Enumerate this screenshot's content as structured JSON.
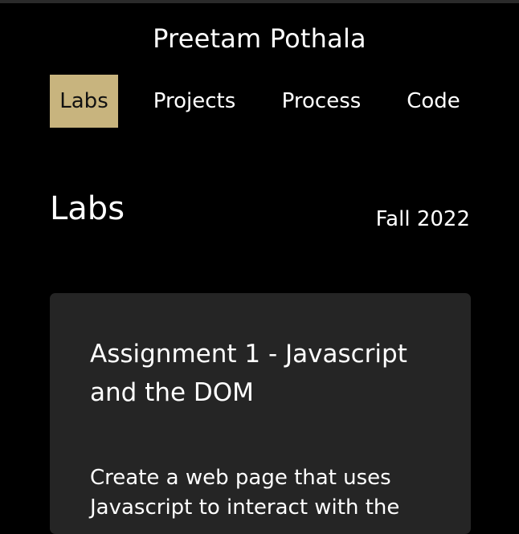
{
  "site": {
    "title": "Preetam Pothala"
  },
  "nav": {
    "items": [
      {
        "label": "Labs",
        "active": true
      },
      {
        "label": "Projects",
        "active": false
      },
      {
        "label": "Process",
        "active": false
      },
      {
        "label": "Code",
        "active": false
      }
    ]
  },
  "main": {
    "heading": "Labs",
    "term": "Fall 2022",
    "cards": [
      {
        "title": "Assignment 1 - Javascript and the DOM",
        "description": "Create a web page that uses Javascript to interact with the"
      }
    ]
  },
  "colors": {
    "background": "#000000",
    "active_nav": "#c8b47e",
    "card_background": "#252525",
    "text": "#ffffff"
  }
}
